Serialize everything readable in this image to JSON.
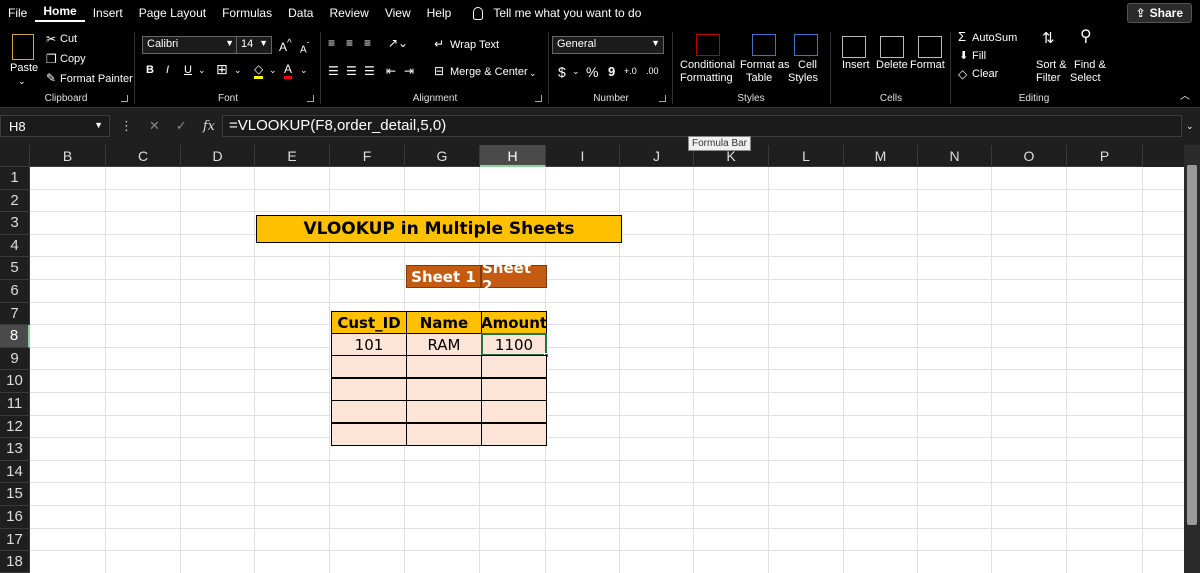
{
  "menu": {
    "items": [
      "File",
      "Home",
      "Insert",
      "Page Layout",
      "Formulas",
      "Data",
      "Review",
      "View",
      "Help"
    ],
    "tell_me": "Tell me what you want to do",
    "share": "Share"
  },
  "ribbon": {
    "clipboard": {
      "paste": "Paste",
      "cut": "Cut",
      "copy": "Copy",
      "format_painter": "Format Painter",
      "title": "Clipboard"
    },
    "font": {
      "name": "Calibri",
      "size": "14",
      "bold": "B",
      "italic": "I",
      "underline": "U",
      "title": "Font"
    },
    "alignment": {
      "wrap": "Wrap Text",
      "merge": "Merge & Center",
      "title": "Alignment"
    },
    "number": {
      "format": "General",
      "currency": "$",
      "percent": "%",
      "comma": "9",
      "title": "Number"
    },
    "styles": {
      "conditional_1": "Conditional",
      "conditional_2": "Formatting",
      "format_as_1": "Format as",
      "format_as_2": "Table",
      "cell_styles_1": "Cell",
      "cell_styles_2": "Styles",
      "title": "Styles"
    },
    "cells": {
      "insert": "Insert",
      "delete": "Delete",
      "format": "Format",
      "title": "Cells"
    },
    "editing": {
      "autosum": "AutoSum",
      "fill": "Fill",
      "clear": "Clear",
      "sort_1": "Sort &",
      "sort_2": "Filter",
      "find_1": "Find &",
      "find_2": "Select",
      "title": "Editing"
    }
  },
  "formula_bar": {
    "name_box": "H8",
    "fx": "fx",
    "formula": "=VLOOKUP(F8,order_detail,5,0)",
    "tooltip": "Formula Bar"
  },
  "grid": {
    "columns": [
      "B",
      "C",
      "D",
      "E",
      "F",
      "G",
      "H",
      "I",
      "J",
      "K",
      "L",
      "M",
      "N",
      "O",
      "P"
    ],
    "rows": [
      "1",
      "2",
      "3",
      "4",
      "5",
      "6",
      "7",
      "8",
      "9",
      "10",
      "11",
      "12",
      "13",
      "14",
      "15",
      "16",
      "17",
      "18"
    ],
    "selected_column": "H",
    "selected_row": "8"
  },
  "content": {
    "title": "VLOOKUP in Multiple Sheets",
    "sheet1": "Sheet 1",
    "sheet2": "Sheet 2",
    "headers": [
      "Cust_ID",
      "Name",
      "Amount"
    ],
    "row1": [
      "101",
      "RAM",
      "1100"
    ]
  }
}
